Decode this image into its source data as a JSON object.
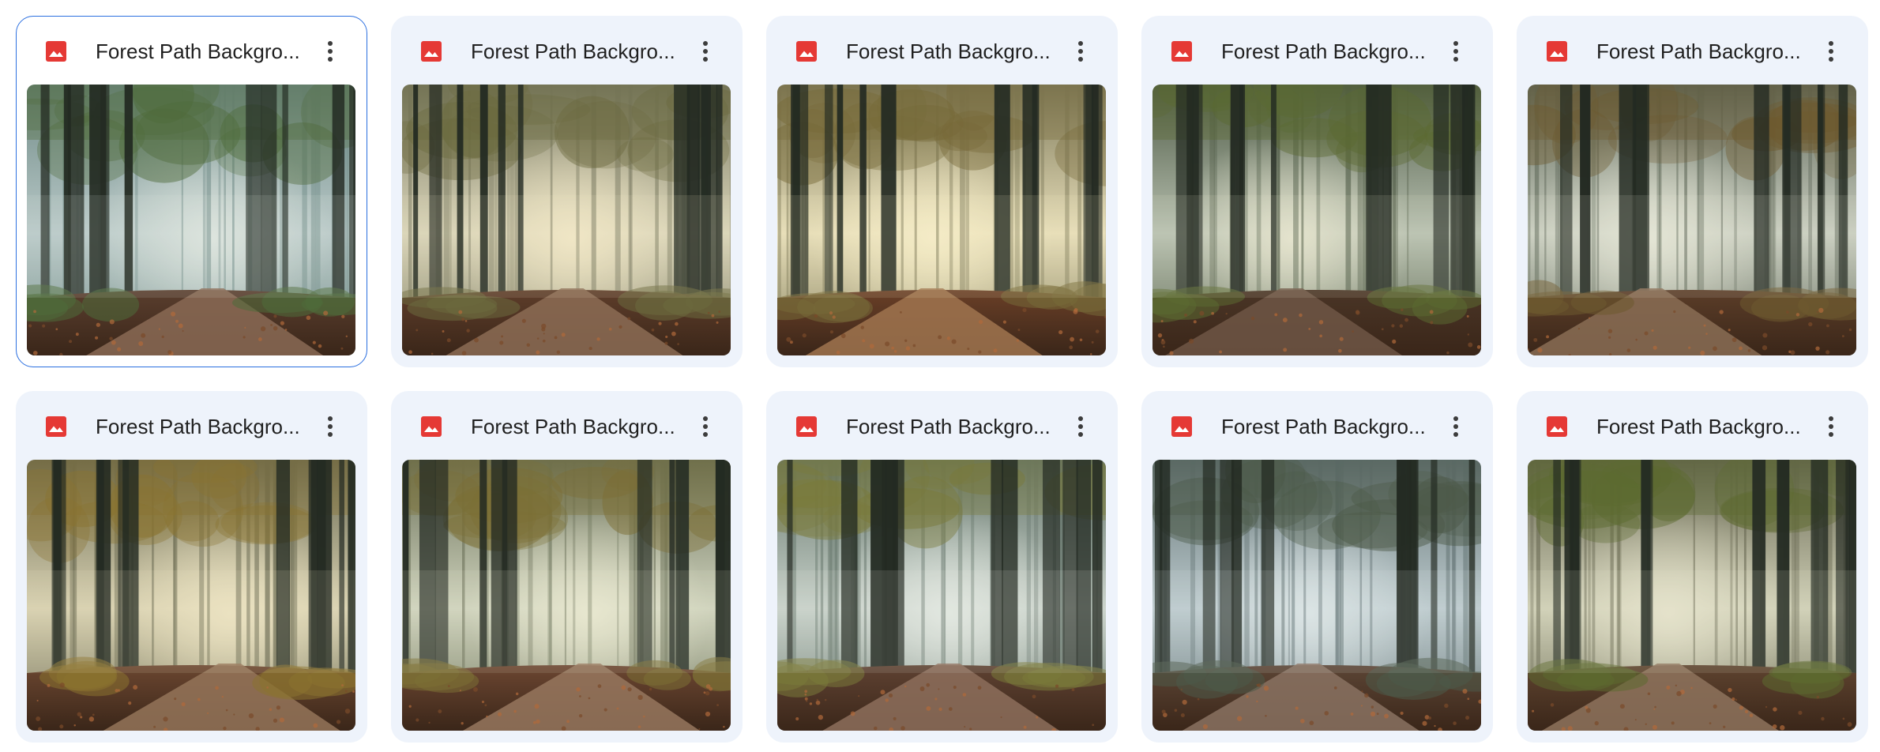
{
  "grid": {
    "files": [
      {
        "name": "Forest Path Backgro...",
        "type": "image",
        "selected": true,
        "scene": {
          "sky": "#b9c9c8",
          "mid": "#6f8a86",
          "ground": "#5a3e2e",
          "path": "#8a6a55",
          "light": "#dfe6df",
          "accent": "#4f6b3a"
        }
      },
      {
        "name": "Forest Path Backgro...",
        "type": "image",
        "selected": false,
        "scene": {
          "sky": "#d9d4b8",
          "mid": "#7a7a62",
          "ground": "#5e3d2a",
          "path": "#8c6c55",
          "light": "#f1e7c6",
          "accent": "#6b6a3e"
        }
      },
      {
        "name": "Forest Path Backgro...",
        "type": "image",
        "selected": false,
        "scene": {
          "sky": "#e6ddb8",
          "mid": "#7e7a5a",
          "ground": "#6a3f27",
          "path": "#a0744f",
          "light": "#f5ecc7",
          "accent": "#776a39"
        }
      },
      {
        "name": "Forest Path Backgro...",
        "type": "image",
        "selected": false,
        "scene": {
          "sky": "#b7c0b0",
          "mid": "#4e5a45",
          "ground": "#4a3526",
          "path": "#6f5645",
          "light": "#e7e5cf",
          "accent": "#5b6a32"
        }
      },
      {
        "name": "Forest Path Backgro...",
        "type": "image",
        "selected": false,
        "scene": {
          "sky": "#c8cdbf",
          "mid": "#5e6758",
          "ground": "#5b3d28",
          "path": "#8a6d55",
          "light": "#e5e6d6",
          "accent": "#6e5a2f"
        }
      },
      {
        "name": "Forest Path Backgro...",
        "type": "image",
        "selected": false,
        "scene": {
          "sky": "#d7d0b0",
          "mid": "#6a6a52",
          "ground": "#6b4630",
          "path": "#947459",
          "light": "#ece3c2",
          "accent": "#8a7330"
        }
      },
      {
        "name": "Forest Path Backgro...",
        "type": "image",
        "selected": false,
        "scene": {
          "sky": "#cfd3bd",
          "mid": "#6a7058",
          "ground": "#6c4631",
          "path": "#97775e",
          "light": "#e9e8d0",
          "accent": "#7c6f35"
        }
      },
      {
        "name": "Forest Path Backgro...",
        "type": "image",
        "selected": false,
        "scene": {
          "sky": "#c7d1c9",
          "mid": "#66766c",
          "ground": "#5f4232",
          "path": "#8d6f5c",
          "light": "#e3e9e2",
          "accent": "#7a7a3a"
        }
      },
      {
        "name": "Forest Path Backgro...",
        "type": "image",
        "selected": false,
        "scene": {
          "sky": "#bccacd",
          "mid": "#627273",
          "ground": "#5c4535",
          "path": "#8a7262",
          "light": "#dde6e6",
          "accent": "#4c5a48"
        }
      },
      {
        "name": "Forest Path Backgro...",
        "type": "image",
        "selected": false,
        "scene": {
          "sky": "#cfcfb6",
          "mid": "#666650",
          "ground": "#5e432f",
          "path": "#8e735d",
          "light": "#e6e3cc",
          "accent": "#5d6a30"
        }
      }
    ]
  },
  "icons": {
    "file_type": "image-file-icon",
    "more": "more-vert-icon"
  },
  "colors": {
    "card_bg": "#eef3fb",
    "selected_border": "#2b6fe0",
    "image_icon": "#e53935",
    "title_text": "#1f1f1f",
    "more_icon": "#3c3c3c"
  }
}
